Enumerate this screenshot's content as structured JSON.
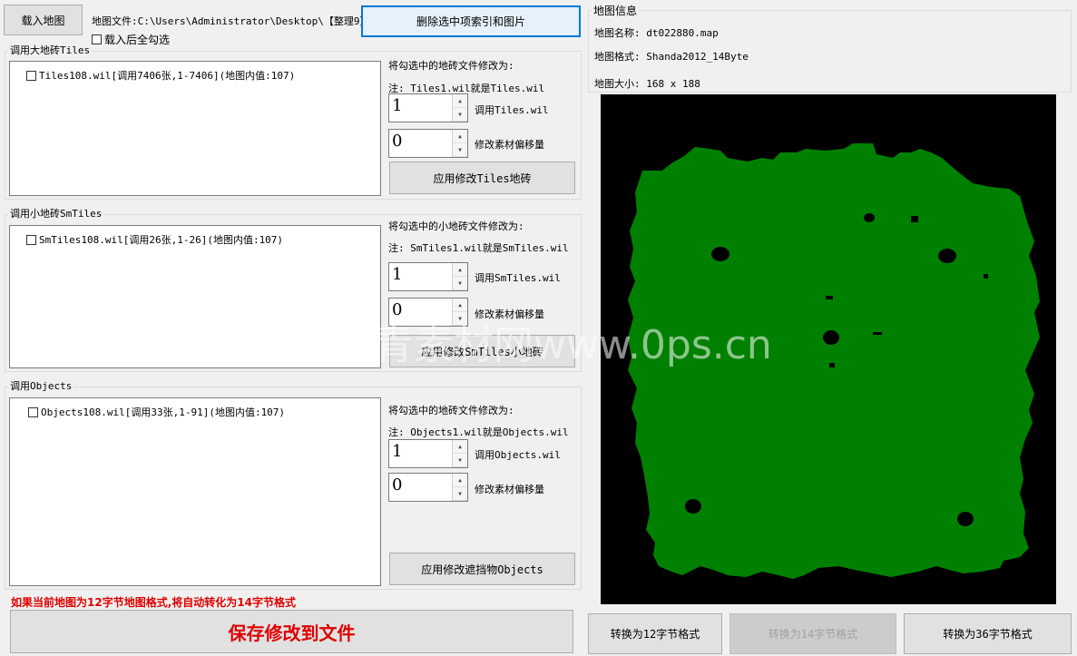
{
  "top": {
    "load_map": "载入地图",
    "map_file": "地图文件:C:\\Users\\Administrator\\Desktop\\【整理9】:",
    "select_all_after_load": "载入后全勾选",
    "delete_selected": "删除选中项索引和图片"
  },
  "tiles": {
    "group_title": "调用大地砖Tiles",
    "item": "Tiles108.wil[调用7406张,1-7406](地图内值:107)",
    "change_label": "将勾选中的地砖文件修改为:",
    "note": "注: Tiles1.wil就是Tiles.wil",
    "spin1_value": "1",
    "spin1_label": "调用Tiles.wil",
    "spin2_value": "0",
    "spin2_label": "修改素材偏移量",
    "apply": "应用修改Tiles地砖"
  },
  "smtiles": {
    "group_title": "调用小地砖SmTiles",
    "item": "SmTiles108.wil[调用26张,1-26](地图内值:107)",
    "change_label": "将勾选中的小地砖文件修改为:",
    "note": "注: SmTiles1.wil就是SmTiles.wil",
    "spin1_value": "1",
    "spin1_label": "调用SmTiles.wil",
    "spin2_value": "0",
    "spin2_label": "修改素材偏移量",
    "apply": "应用修改SmTiles小地砖"
  },
  "objects": {
    "group_title": "调用Objects",
    "item": "Objects108.wil[调用33张,1-91](地图内值:107)",
    "change_label": "将勾选中的地砖文件修改为:",
    "note": "注: Objects1.wil就是Objects.wil",
    "spin1_value": "1",
    "spin1_label": "调用Objects.wil",
    "spin2_value": "0",
    "spin2_label": "修改素材偏移量",
    "apply": "应用修改遮挡物Objects"
  },
  "footer": {
    "note": "如果当前地图为12字节地图格式,将自动转化为14字节格式",
    "save": "保存修改到文件"
  },
  "map_info": {
    "group_title": "地图信息",
    "name": "地图名称: dt022880.map",
    "format": "地图格式: Shanda2012_14Byte",
    "size": "地图大小: 168 x 188"
  },
  "convert": {
    "to12": "转换为12字节格式",
    "to14": "转换为14字节格式",
    "to36": "转换为36字节格式"
  },
  "watermark": "青素材网www.0ps.cn",
  "colors": {
    "map_bg": "#000000",
    "map_land": "#008000",
    "accent": "#0078d7",
    "warning": "#e00000"
  }
}
